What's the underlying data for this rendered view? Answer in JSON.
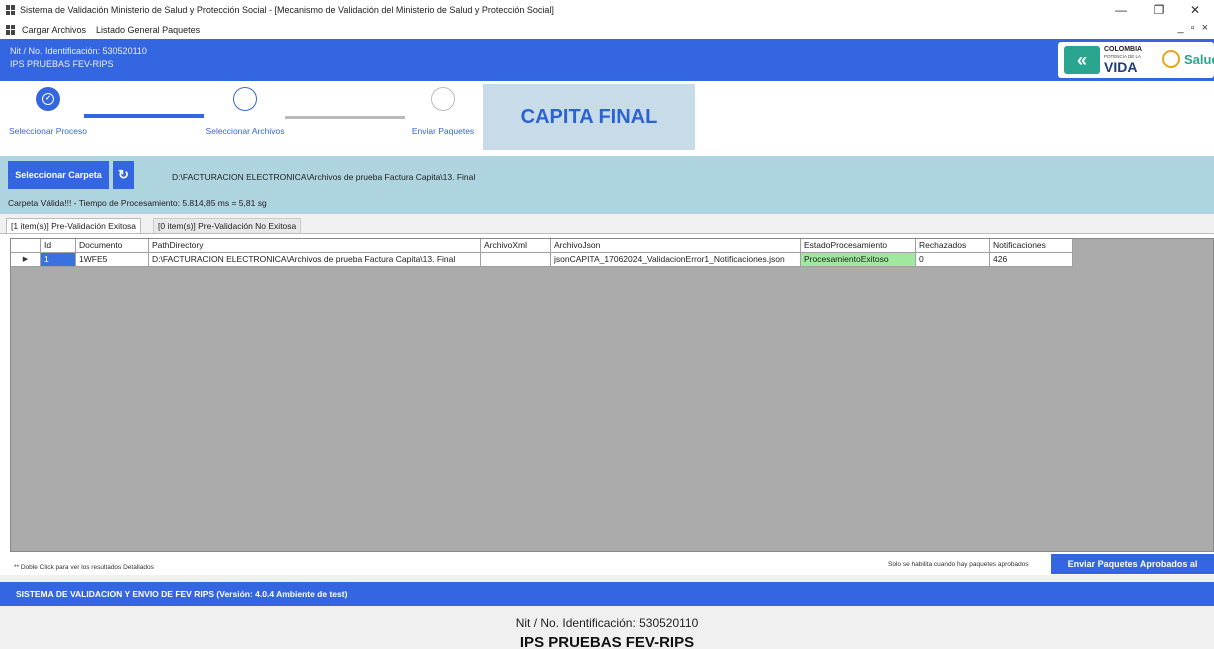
{
  "window": {
    "title": "Sistema de Validación Ministerio de Salud y Protección Social - [Mecanismo de Validación del Ministerio de Salud y Protección Social]",
    "minimize": "—",
    "restore": "❐",
    "close": "✕"
  },
  "menu": {
    "items": [
      "Cargar Archivos",
      "Listado General Paquetes"
    ],
    "mdi_controls": "_ ▫ ×"
  },
  "header": {
    "nit": "Nit / No. Identificación: 530520110",
    "ips": "IPS PRUEBAS FEV-RIPS",
    "logo_colombia": "COLOMBIA",
    "logo_potencia": "POTENCIA DE LA",
    "logo_vida": "VIDA",
    "logo_salud": "Salud",
    "accent_color": "#3366e0"
  },
  "wizard": {
    "steps": [
      {
        "label": "Seleccionar Proceso",
        "status": "done"
      },
      {
        "label": "Seleccionar Archivos",
        "status": "active"
      },
      {
        "label": "Enviar Paquetes",
        "status": "pending"
      }
    ],
    "process_name": "CAPITA FINAL"
  },
  "toolbar": {
    "select_folder_label": "Seleccionar Carpeta",
    "refresh_icon": "↻",
    "folder_path": "D:\\FACTURACION ELECTRONICA\\Archivos de prueba Factura Capita\\13. Final",
    "validation_message": "Carpeta Válida!!! - Tiempo de Procesamiento: 5.814,85 ms = 5,81 sg"
  },
  "tabs": [
    {
      "label": "[1 item(s)] Pre-Validación Exitosa",
      "active": true
    },
    {
      "label": "[0 item(s)] Pre-Validación No Exitosa",
      "active": false
    }
  ],
  "grid": {
    "columns": [
      "Id",
      "Documento",
      "PathDirectory",
      "ArchivoXml",
      "ArchivoJson",
      "EstadoProcesamiento",
      "Rechazados",
      "Notificaciones"
    ],
    "rows": [
      {
        "marker": "▶",
        "Id": "1",
        "Documento": "1WFE5",
        "PathDirectory": "D:\\FACTURACION ELECTRONICA\\Archivos de prueba Factura Capita\\13. Final",
        "ArchivoXml": "",
        "ArchivoJson": "jsonCAPITA_17062024_ValidacionError1_Notificaciones.json",
        "EstadoProcesamiento": "ProcesamientoExitoso",
        "Rechazados": "0",
        "Notificaciones": "426"
      }
    ],
    "success_color": "#9fe89f",
    "selection_color": "#3a70df"
  },
  "footer": {
    "hint": "** Doble Click para ver los resultados Detallados",
    "only_enabled_msg": "Solo se habilita cuando hay paquetes aprobados",
    "send_button": "Enviar Paquetes Aprobados al"
  },
  "statusbar": {
    "text": "SISTEMA DE VALIDACION Y ENVIO DE FEV RIPS  (Versión: 4.0.4 Ambiente de test)"
  },
  "bottom": {
    "nit": "Nit / No. Identificación: 530520110",
    "ips": "IPS PRUEBAS FEV-RIPS"
  }
}
